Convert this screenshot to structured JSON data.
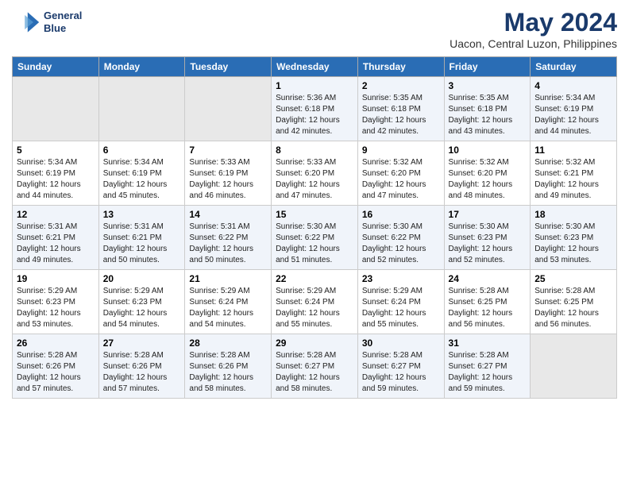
{
  "header": {
    "logo_line1": "General",
    "logo_line2": "Blue",
    "title": "May 2024",
    "subtitle": "Uacon, Central Luzon, Philippines"
  },
  "weekdays": [
    "Sunday",
    "Monday",
    "Tuesday",
    "Wednesday",
    "Thursday",
    "Friday",
    "Saturday"
  ],
  "weeks": [
    [
      {
        "num": "",
        "info": ""
      },
      {
        "num": "",
        "info": ""
      },
      {
        "num": "",
        "info": ""
      },
      {
        "num": "1",
        "info": "Sunrise: 5:36 AM\nSunset: 6:18 PM\nDaylight: 12 hours\nand 42 minutes."
      },
      {
        "num": "2",
        "info": "Sunrise: 5:35 AM\nSunset: 6:18 PM\nDaylight: 12 hours\nand 42 minutes."
      },
      {
        "num": "3",
        "info": "Sunrise: 5:35 AM\nSunset: 6:18 PM\nDaylight: 12 hours\nand 43 minutes."
      },
      {
        "num": "4",
        "info": "Sunrise: 5:34 AM\nSunset: 6:19 PM\nDaylight: 12 hours\nand 44 minutes."
      }
    ],
    [
      {
        "num": "5",
        "info": "Sunrise: 5:34 AM\nSunset: 6:19 PM\nDaylight: 12 hours\nand 44 minutes."
      },
      {
        "num": "6",
        "info": "Sunrise: 5:34 AM\nSunset: 6:19 PM\nDaylight: 12 hours\nand 45 minutes."
      },
      {
        "num": "7",
        "info": "Sunrise: 5:33 AM\nSunset: 6:19 PM\nDaylight: 12 hours\nand 46 minutes."
      },
      {
        "num": "8",
        "info": "Sunrise: 5:33 AM\nSunset: 6:20 PM\nDaylight: 12 hours\nand 47 minutes."
      },
      {
        "num": "9",
        "info": "Sunrise: 5:32 AM\nSunset: 6:20 PM\nDaylight: 12 hours\nand 47 minutes."
      },
      {
        "num": "10",
        "info": "Sunrise: 5:32 AM\nSunset: 6:20 PM\nDaylight: 12 hours\nand 48 minutes."
      },
      {
        "num": "11",
        "info": "Sunrise: 5:32 AM\nSunset: 6:21 PM\nDaylight: 12 hours\nand 49 minutes."
      }
    ],
    [
      {
        "num": "12",
        "info": "Sunrise: 5:31 AM\nSunset: 6:21 PM\nDaylight: 12 hours\nand 49 minutes."
      },
      {
        "num": "13",
        "info": "Sunrise: 5:31 AM\nSunset: 6:21 PM\nDaylight: 12 hours\nand 50 minutes."
      },
      {
        "num": "14",
        "info": "Sunrise: 5:31 AM\nSunset: 6:22 PM\nDaylight: 12 hours\nand 50 minutes."
      },
      {
        "num": "15",
        "info": "Sunrise: 5:30 AM\nSunset: 6:22 PM\nDaylight: 12 hours\nand 51 minutes."
      },
      {
        "num": "16",
        "info": "Sunrise: 5:30 AM\nSunset: 6:22 PM\nDaylight: 12 hours\nand 52 minutes."
      },
      {
        "num": "17",
        "info": "Sunrise: 5:30 AM\nSunset: 6:23 PM\nDaylight: 12 hours\nand 52 minutes."
      },
      {
        "num": "18",
        "info": "Sunrise: 5:30 AM\nSunset: 6:23 PM\nDaylight: 12 hours\nand 53 minutes."
      }
    ],
    [
      {
        "num": "19",
        "info": "Sunrise: 5:29 AM\nSunset: 6:23 PM\nDaylight: 12 hours\nand 53 minutes."
      },
      {
        "num": "20",
        "info": "Sunrise: 5:29 AM\nSunset: 6:23 PM\nDaylight: 12 hours\nand 54 minutes."
      },
      {
        "num": "21",
        "info": "Sunrise: 5:29 AM\nSunset: 6:24 PM\nDaylight: 12 hours\nand 54 minutes."
      },
      {
        "num": "22",
        "info": "Sunrise: 5:29 AM\nSunset: 6:24 PM\nDaylight: 12 hours\nand 55 minutes."
      },
      {
        "num": "23",
        "info": "Sunrise: 5:29 AM\nSunset: 6:24 PM\nDaylight: 12 hours\nand 55 minutes."
      },
      {
        "num": "24",
        "info": "Sunrise: 5:28 AM\nSunset: 6:25 PM\nDaylight: 12 hours\nand 56 minutes."
      },
      {
        "num": "25",
        "info": "Sunrise: 5:28 AM\nSunset: 6:25 PM\nDaylight: 12 hours\nand 56 minutes."
      }
    ],
    [
      {
        "num": "26",
        "info": "Sunrise: 5:28 AM\nSunset: 6:26 PM\nDaylight: 12 hours\nand 57 minutes."
      },
      {
        "num": "27",
        "info": "Sunrise: 5:28 AM\nSunset: 6:26 PM\nDaylight: 12 hours\nand 57 minutes."
      },
      {
        "num": "28",
        "info": "Sunrise: 5:28 AM\nSunset: 6:26 PM\nDaylight: 12 hours\nand 58 minutes."
      },
      {
        "num": "29",
        "info": "Sunrise: 5:28 AM\nSunset: 6:27 PM\nDaylight: 12 hours\nand 58 minutes."
      },
      {
        "num": "30",
        "info": "Sunrise: 5:28 AM\nSunset: 6:27 PM\nDaylight: 12 hours\nand 59 minutes."
      },
      {
        "num": "31",
        "info": "Sunrise: 5:28 AM\nSunset: 6:27 PM\nDaylight: 12 hours\nand 59 minutes."
      },
      {
        "num": "",
        "info": ""
      }
    ]
  ]
}
